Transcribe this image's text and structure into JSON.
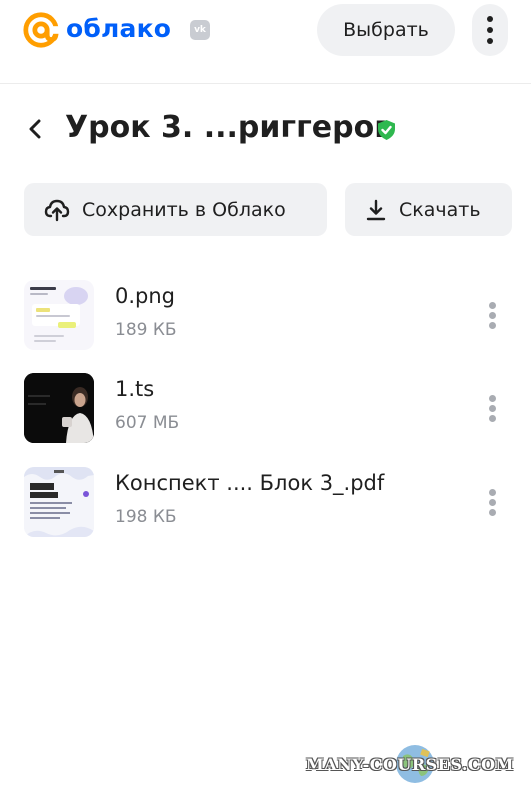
{
  "header": {
    "logo_text": "облако",
    "vk_badge": "vk",
    "select_label": "Выбрать",
    "menu_icon": "more-vertical-icon",
    "brand_color": "#005ff9",
    "accent_color": "#ff9e00"
  },
  "folder": {
    "title": "Урок 3. ...риггеров",
    "back_icon": "chevron-left-icon",
    "verified_icon": "shield-check-icon",
    "verified_color": "#2fb84f"
  },
  "actions": {
    "save_label": "Сохранить в Облако",
    "save_icon": "cloud-upload-icon",
    "download_label": "Скачать",
    "download_icon": "download-icon"
  },
  "files": [
    {
      "name": "0.png",
      "size": "189 КБ",
      "icon": "image-thumbnail"
    },
    {
      "name": "1.ts",
      "size": "607 МБ",
      "icon": "video-thumbnail"
    },
    {
      "name": "Конспект .... Блок 3_.pdf",
      "size": "198 КБ",
      "icon": "pdf-thumbnail"
    }
  ],
  "watermark": {
    "text": "MANY-COURSES.COM"
  }
}
